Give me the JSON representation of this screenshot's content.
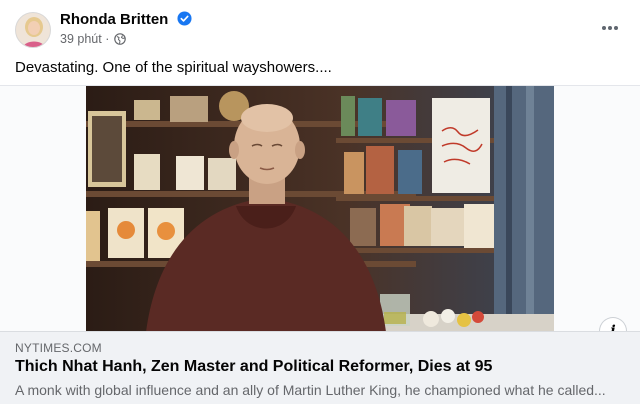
{
  "post": {
    "author": "Rhonda Britten",
    "time": "39 phút",
    "more_icon": "ellipsis-horizontal-icon",
    "verified_icon": "verified-badge-icon",
    "privacy_icon": "globe-icon",
    "text": "Devastating. One of the spiritual wayshowers...."
  },
  "link_preview": {
    "domain": "NYTIMES.COM",
    "title": "Thich Nhat Hanh, Zen Master and Political Reformer, Dies at 95",
    "description": "A monk with global influence and an ally of Martin Luther King, he championed what he called...",
    "info_icon": "info-icon",
    "info_label": "i"
  },
  "colors": {
    "verified_blue": "#1877f2",
    "secondary_text": "#65676b",
    "footer_bg": "#f0f2f5"
  }
}
